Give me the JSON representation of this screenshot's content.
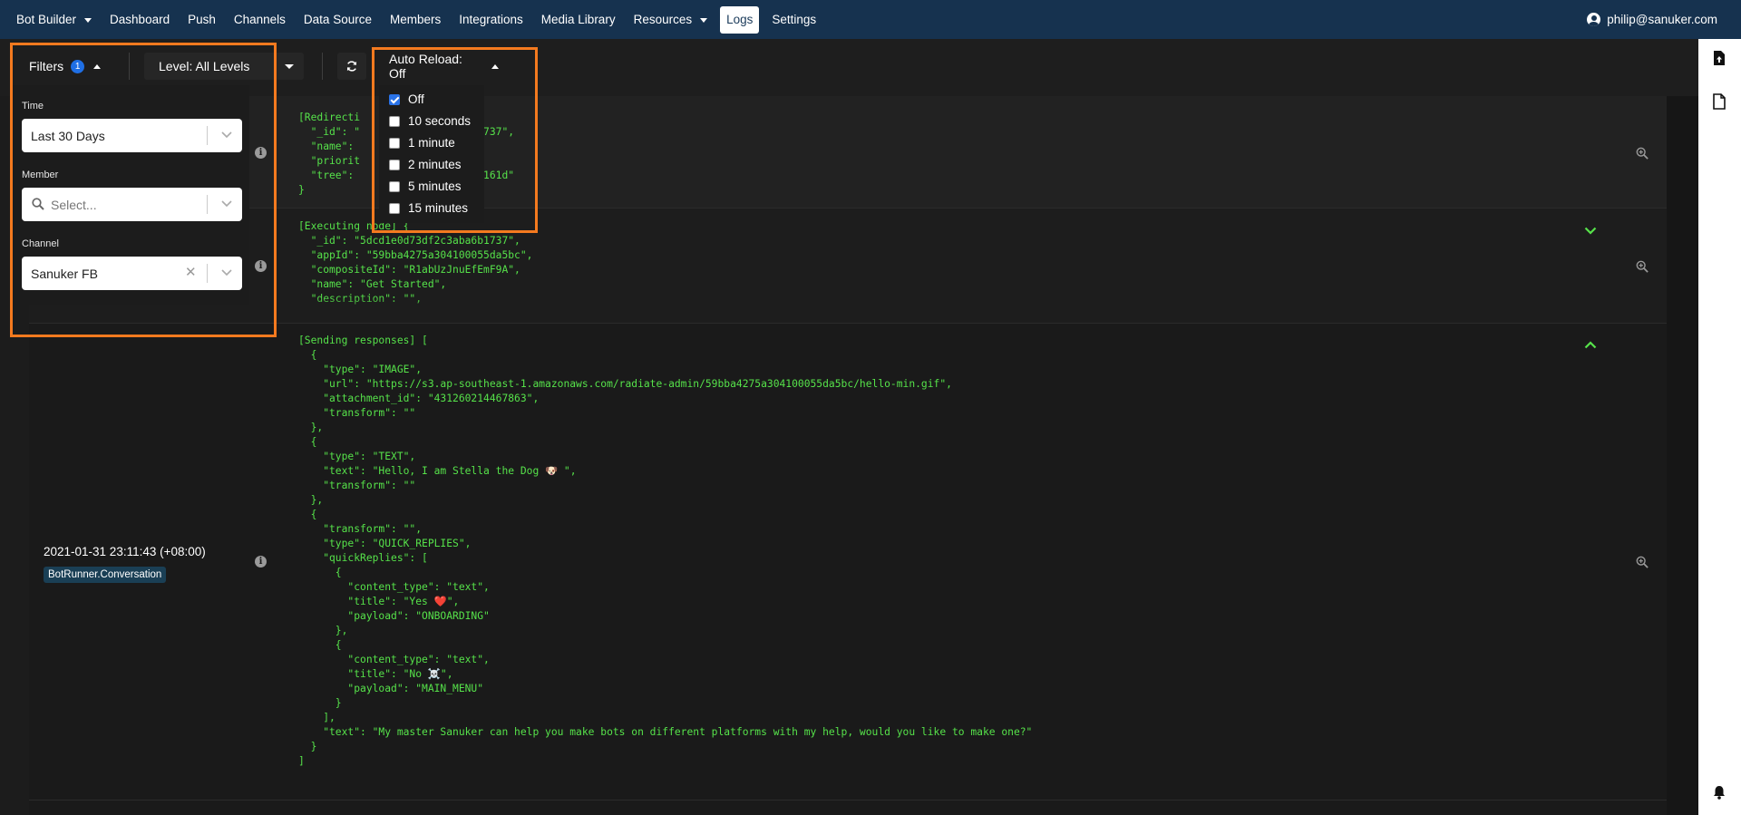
{
  "nav": {
    "brand": "Bot Builder",
    "items": [
      "Dashboard",
      "Push",
      "Channels",
      "Data Source",
      "Members",
      "Integrations",
      "Media Library",
      "Resources",
      "Logs",
      "Settings"
    ],
    "active": "Logs",
    "user": "philip@sanuker.com"
  },
  "toolbar": {
    "filters_label": "Filters",
    "filters_count": "1",
    "level_label": "Level: All Levels",
    "auto_reload_label": "Auto Reload: Off"
  },
  "filters": {
    "time_label": "Time",
    "time_value": "Last 30 Days",
    "member_label": "Member",
    "member_placeholder": "Select...",
    "channel_label": "Channel",
    "channel_value": "Sanuker FB"
  },
  "auto_reload": {
    "options": [
      {
        "label": "Off",
        "checked": true
      },
      {
        "label": "10 seconds",
        "checked": false
      },
      {
        "label": "1 minute",
        "checked": false
      },
      {
        "label": "2 minutes",
        "checked": false
      },
      {
        "label": "5 minutes",
        "checked": false
      },
      {
        "label": "15 minutes",
        "checked": false
      }
    ]
  },
  "logs": [
    {
      "lines": [
        "[Redirecti",
        "  \"_id\": \"              aba6b1737\",",
        "  \"name\": ",
        "  \"priorit",
        "  \"tree\":               7144bd161d\"",
        "}"
      ]
    },
    {
      "lines": [
        "[Executing node] {",
        "  \"_id\": \"5dcd1e0d73df2c3aba6b1737\",",
        "  \"appId\": \"59bba4275a304100055da5bc\",",
        "  \"compositeId\": \"R1abUzJnuEfEmF9A\",",
        "  \"name\": \"Get Started\",",
        "  \"description\": \"\","
      ]
    },
    {
      "time": "2021-01-31 23:11:43 (+08:00)",
      "tag": "BotRunner.Conversation",
      "lines": [
        "[Sending responses] [",
        "  {",
        "    \"type\": \"IMAGE\",",
        "    \"url\": \"https://s3.ap-southeast-1.amazonaws.com/radiate-admin/59bba4275a304100055da5bc/hello-min.gif\",",
        "    \"attachment_id\": \"431260214467863\",",
        "    \"transform\": \"\"",
        "  },",
        "  {",
        "    \"type\": \"TEXT\",",
        "    \"text\": \"Hello, I am Stella the Dog 🐶 \",",
        "    \"transform\": \"\"",
        "  },",
        "  {",
        "    \"transform\": \"\",",
        "    \"type\": \"QUICK_REPLIES\",",
        "    \"quickReplies\": [",
        "      {",
        "        \"content_type\": \"text\",",
        "        \"title\": \"Yes ❤️\",",
        "        \"payload\": \"ONBOARDING\"",
        "      },",
        "      {",
        "        \"content_type\": \"text\",",
        "        \"title\": \"No ☠️\",",
        "        \"payload\": \"MAIN_MENU\"",
        "      }",
        "    ],",
        "    \"text\": \"My master Sanuker can help you make bots on different platforms with my help, would you like to make one?\"",
        "  }",
        "]"
      ]
    }
  ],
  "colors": {
    "nav_bg": "#16324f",
    "code_green": "#56e24a",
    "highlight": "#f47a1f",
    "badge_blue": "#1f6fe5"
  }
}
